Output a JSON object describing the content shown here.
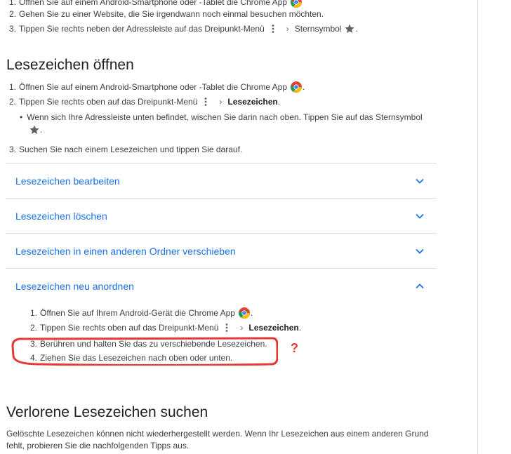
{
  "top_steps": [
    {
      "num": "1.",
      "text": "Öffnen Sie auf einem Android-Smartphone oder -Tablet die Chrome App"
    },
    {
      "num": "2.",
      "text": "Gehen Sie zu einer Website, die Sie irgendwann noch einmal besuchen möchten."
    },
    {
      "num": "3.",
      "text": "Tippen Sie rechts neben der Adressleiste auf das Dreipunkt-Menü",
      "after": "Sternsymbol",
      "end": "."
    }
  ],
  "open_section": {
    "heading": "Lesezeichen öffnen",
    "steps": [
      {
        "num": "1.",
        "text": "Öffnen Sie auf einem Android-Smartphone oder -Tablet die Chrome App",
        "end": "."
      },
      {
        "num": "2.",
        "text": "Tippen Sie rechts oben auf das Dreipunkt-Menü",
        "bold": "Lesezeichen",
        "end": "."
      },
      {
        "num": "3.",
        "text": "Suchen Sie nach einem Lesezeichen und tippen Sie darauf."
      }
    ],
    "bullet": "Wenn sich Ihre Adressleiste unten befindet, wischen Sie darin nach oben. Tippen Sie auf das Sternsymbol",
    "bullet_end": "."
  },
  "accordion": [
    {
      "label": "Lesezeichen bearbeiten",
      "expanded": false
    },
    {
      "label": "Lesezeichen löschen",
      "expanded": false
    },
    {
      "label": "Lesezeichen in einen anderen Ordner verschieben",
      "expanded": false
    },
    {
      "label": "Lesezeichen neu anordnen",
      "expanded": true
    }
  ],
  "reorder_steps": [
    {
      "num": "1.",
      "text": "Öffnen Sie auf Ihrem Android-Gerät die Chrome App",
      "end": "."
    },
    {
      "num": "2.",
      "text": "Tippen Sie rechts oben auf das Dreipunkt-Menü",
      "bold": "Lesezeichen",
      "end": "."
    },
    {
      "num": "3.",
      "text": "Berühren und halten Sie das zu verschiebende Lesezeichen."
    },
    {
      "num": "4.",
      "text": "Ziehen Sie das Lesezeichen nach oben oder unten."
    }
  ],
  "lost_section": {
    "heading": "Verlorene Lesezeichen suchen",
    "line1": "Gelöschte Lesezeichen können nicht wiederhergestellt werden. Wenn Ihr Lesezeichen aus einem anderen Grund",
    "line2": "fehlt, probieren Sie die nachfolgenden Tipps aus."
  },
  "annotation": {
    "mark": "?",
    "color": "#e53935"
  },
  "colors": {
    "link": "#1a73e8",
    "text": "#3c4043",
    "divider": "#dadce0"
  }
}
